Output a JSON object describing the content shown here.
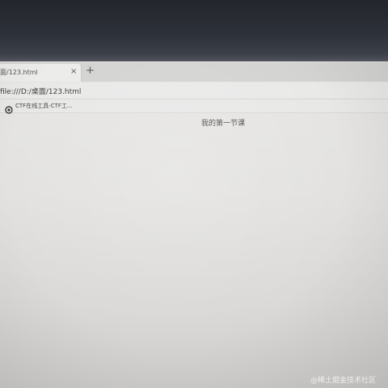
{
  "tab": {
    "title": "面/123.html",
    "close_glyph": "×"
  },
  "new_tab_glyph": "+",
  "address_bar": {
    "url": "file:///D:/桌面/123.html"
  },
  "bookmarks": [
    {
      "label": "CTF在线工具-CTF工..."
    }
  ],
  "page": {
    "text": "我的第一节课"
  },
  "watermark": "@稀土掘金技术社区",
  "colors": {
    "bezel": "#2d3139",
    "tab_active": "#ececeb",
    "tab_strip": "#d3d3d2",
    "page_bg": "#e3e2e0"
  }
}
